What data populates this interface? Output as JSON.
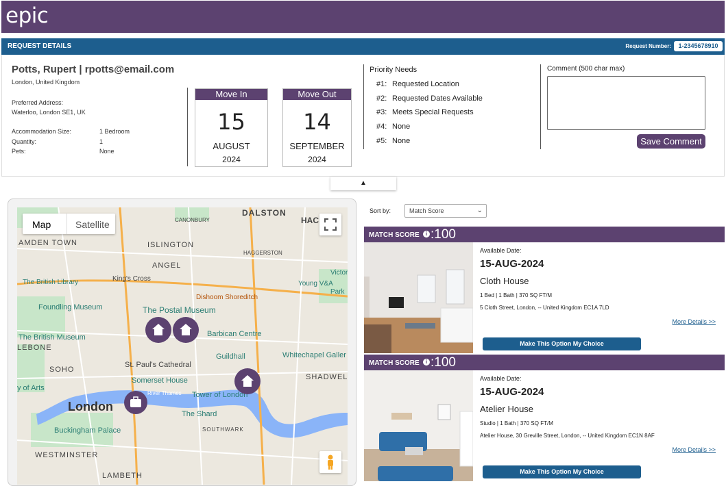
{
  "app": {
    "logo": "epic"
  },
  "request_bar": {
    "title": "REQUEST DETAILS",
    "number_label": "Request Number:",
    "number_value": "1-2345678910"
  },
  "guest": {
    "name": "Potts, Rupert | rpotts@email.com",
    "location": "London, United Kingdom",
    "preferred_label": "Preferred Address:",
    "preferred_value": "Waterloo, London SE1, UK",
    "size_label": "Accommodation Size:",
    "size_value": "1 Bedroom",
    "qty_label": "Quantity:",
    "qty_value": "1",
    "pets_label": "Pets:",
    "pets_value": "None"
  },
  "move_in": {
    "label": "Move In",
    "day": "15",
    "month": "AUGUST",
    "year": "2024"
  },
  "move_out": {
    "label": "Move Out",
    "day": "14",
    "month": "SEPTEMBER",
    "year": "2024"
  },
  "priority": {
    "title": "Priority Needs",
    "items": [
      {
        "n": "#1:",
        "v": "Requested Location"
      },
      {
        "n": "#2:",
        "v": "Requested Dates Available"
      },
      {
        "n": "#3:",
        "v": "Meets Special Requests"
      },
      {
        "n": "#4:",
        "v": "None"
      },
      {
        "n": "#5:",
        "v": "None"
      }
    ]
  },
  "comment": {
    "label": "Comment (500 char max)",
    "value": "",
    "save": "Save Comment"
  },
  "collapse": {
    "glyph": "▲"
  },
  "map": {
    "type_map": "Map",
    "type_satellite": "Satellite",
    "labels": {
      "camden": "AMDEN TOWN",
      "islington": "ISLINGTON",
      "dalston": "DALSTON",
      "canonbury": "CANONBURY",
      "hac": "HAC",
      "haggerston": "HAGGERSTON",
      "angel": "ANGEL",
      "britlib": "The British Library",
      "kingscross": "King's Cross",
      "victoria": "Victoria and Albert",
      "postal": "The Postal Museum",
      "foundling": "Foundling Museum",
      "dishoom": "Dishoom Shoreditch",
      "barbican": "Barbican Centre",
      "britmus": "The British Museum",
      "lebone": "LEBONE",
      "guildhall": "Guildhall",
      "whitechapel": "Whitechapel Galler",
      "soho": "SOHO",
      "stpauls": "St. Paul's Cathedral",
      "somerset": "Somerset House",
      "shadwell": "SHADWELL",
      "arts": "y of Arts",
      "london": "London",
      "thames": "River Thames",
      "tower": "Tower of London",
      "shard": "The Shard",
      "buckingham": "Buckingham Palace",
      "southwark": "SOUTHWARK",
      "westminster": "WESTMINSTER",
      "lambeth": "LAMBETH",
      "vam": "Young V&A",
      "park": "Park"
    }
  },
  "sort": {
    "label": "Sort by:",
    "value": "Match Score"
  },
  "listings": [
    {
      "ms_label": "MATCH SCORE",
      "info": "i",
      "score": ":100",
      "avail_label": "Available Date:",
      "date": "15-AUG-2024",
      "name": "Cloth House",
      "specs": "1 Bed | 1 Bath | 370 SQ FT/M",
      "address": "5 Cloth Street, London, -- United Kingdom EC1A 7LD",
      "more": "More Details >>",
      "choose": "Make This Option My Choice"
    },
    {
      "ms_label": "MATCH SCORE",
      "info": "i",
      "score": ":100",
      "avail_label": "Available Date:",
      "date": "15-AUG-2024",
      "name": "Atelier House",
      "specs": "Studio | 1 Bath | 370 SQ FT/M",
      "address": "Atelier House, 30 Greville Street, London, -- United Kingdom EC1N 8AF",
      "more": "More Details >>",
      "choose": "Make This Option My Choice"
    }
  ],
  "colors": {
    "brand": "#5c4270",
    "blue": "#1d5e8e",
    "thames": "#8ab4f8",
    "park": "#c8e6c9"
  }
}
